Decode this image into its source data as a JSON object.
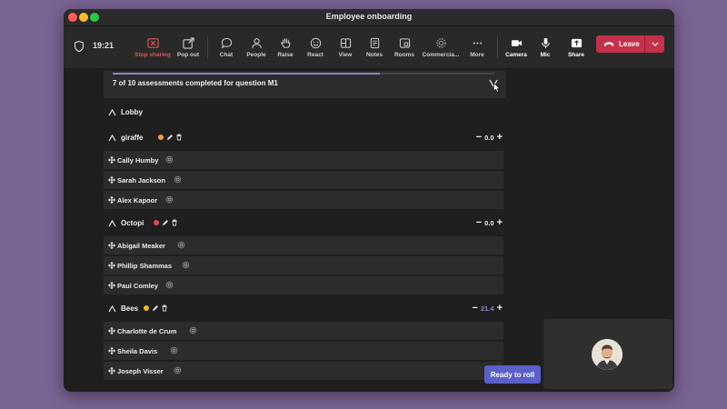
{
  "window": {
    "title": "Employee onboarding"
  },
  "toolbar": {
    "time": "19:21",
    "stop_sharing": "Stop sharing",
    "pop_out": "Pop out",
    "chat": "Chat",
    "people": "People",
    "raise": "Raise",
    "react": "React",
    "view": "View",
    "notes": "Notes",
    "rooms": "Rooms",
    "commercial": "Commercia...",
    "more": "More",
    "camera": "Camera",
    "mic": "Mic",
    "share": "Share",
    "leave": "Leave"
  },
  "progress": {
    "text": "7 of 10 assessments completed for question M1",
    "fraction": 0.7
  },
  "lobby": {
    "title": "Lobby"
  },
  "groups": [
    {
      "name": "giraffe",
      "score": "0.0",
      "members": [
        "Cally Humby",
        "Sarah Jackson",
        "Alex Kapoor"
      ]
    },
    {
      "name": "Octopi",
      "score": "0.0",
      "members": [
        "Abigail Meaker",
        "Phillip Shammas",
        "Paul Comley"
      ]
    },
    {
      "name": "Bees",
      "score": "21.4",
      "members": [
        "Charlotte de Crum",
        "Sheila Davis",
        "Joseph Visser"
      ]
    }
  ],
  "roll_button": "Ready to roll",
  "colors": {
    "accent": "#5b5fc7",
    "leave": "#c4314b",
    "stop": "#e05555",
    "progress": "#8b86c8"
  }
}
